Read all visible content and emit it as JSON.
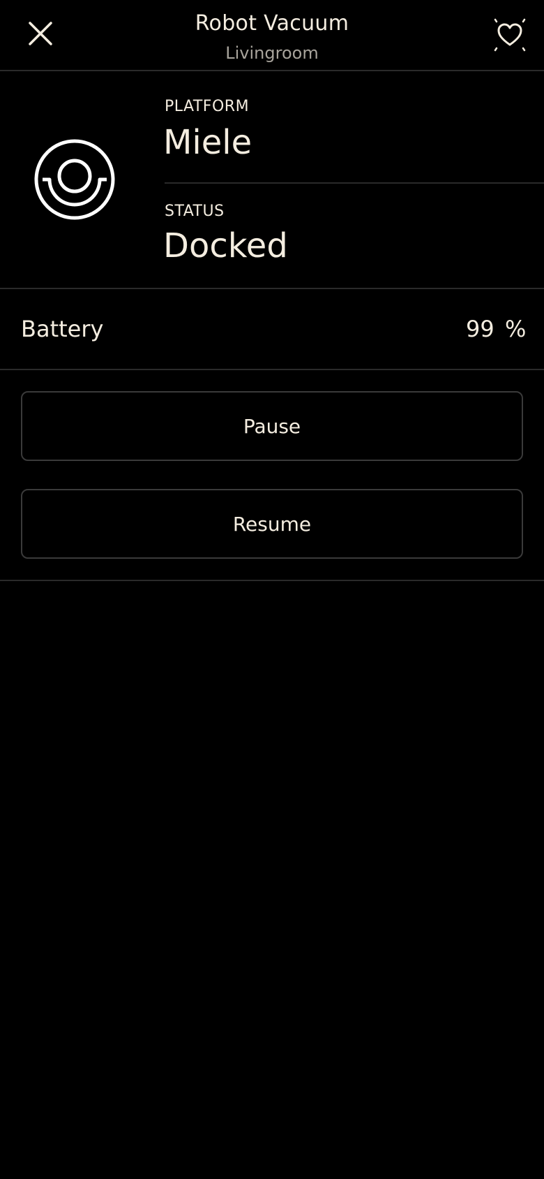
{
  "header": {
    "title": "Robot Vacuum",
    "subtitle": "Livingroom",
    "close_icon": "close-icon",
    "favorite_icon": "heart-sparkle-icon"
  },
  "device": {
    "icon": "robot-vacuum-icon",
    "platform_label": "PLATFORM",
    "platform_value": "Miele",
    "status_label": "STATUS",
    "status_value": "Docked"
  },
  "battery": {
    "label": "Battery",
    "value": "99",
    "unit": "%"
  },
  "actions": {
    "pause_label": "Pause",
    "resume_label": "Resume"
  },
  "colors": {
    "background": "#000000",
    "text": "#f4ede0",
    "muted_text": "#a8a49c",
    "divider": "#2a2a2a"
  }
}
